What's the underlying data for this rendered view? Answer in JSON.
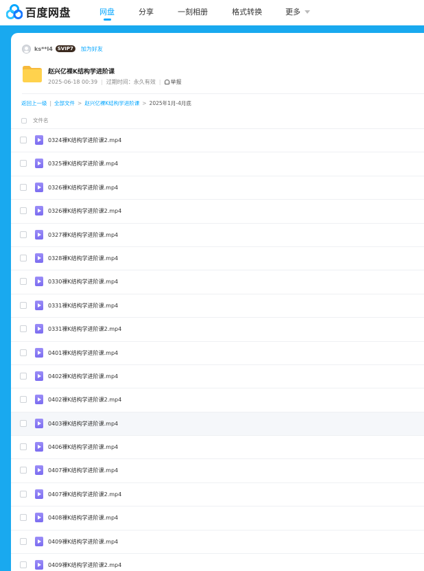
{
  "nav": {
    "logo_text": "百度网盘",
    "items": [
      {
        "label": "网盘",
        "active": true
      },
      {
        "label": "分享",
        "active": false
      },
      {
        "label": "一刻相册",
        "active": false
      },
      {
        "label": "格式转换",
        "active": false
      },
      {
        "label": "更多",
        "active": false
      }
    ]
  },
  "share": {
    "user": "ks**l4",
    "vip_badge": "SVIP7",
    "add_friend": "加为好友",
    "title": "赵兴亿裸K结构学进阶课",
    "date": "2025-06-18 00:39",
    "expiry": "过期时间：永久有效",
    "report": "举报"
  },
  "breadcrumb": {
    "back": "返回上一级",
    "all": "全部文件",
    "folder": "赵兴亿裸K结构学进阶课",
    "current": "2025年1月-4月底"
  },
  "list": {
    "header": "文件名",
    "hover_index": 12,
    "files": [
      "0324裸K结构学进阶课2.mp4",
      "0325裸K结构学进阶课.mp4",
      "0326裸K结构学进阶课.mp4",
      "0326裸K结构学进阶课2.mp4",
      "0327裸K结构学进阶课.mp4",
      "0328裸K结构学进阶课.mp4",
      "0330裸K结构学进阶课.mp4",
      "0331裸K结构学进阶课.mp4",
      "0331裸K结构学进阶课2.mp4",
      "0401裸K结构学进阶课.mp4",
      "0402裸K结构学进阶课.mp4",
      "0402裸K结构学进阶课2.mp4",
      "0403裸K结构学进阶课.mp4",
      "0406裸K结构学进阶课.mp4",
      "0407裸K结构学进阶课.mp4",
      "0407裸K结构学进阶课2.mp4",
      "0408裸K结构学进阶课.mp4",
      "0409裸K结构学进阶课.mp4",
      "0409裸K结构学进阶课2.mp4"
    ]
  },
  "colors": {
    "brand": "#06a7ff",
    "background": "#19a9ef",
    "video_icon": "#8b7cf5"
  },
  "icons": {
    "logo": "baidu-netdisk-logo-icon",
    "folder": "folder-icon",
    "video": "video-file-icon",
    "report": "report-icon",
    "more": "chevron-down-icon"
  }
}
